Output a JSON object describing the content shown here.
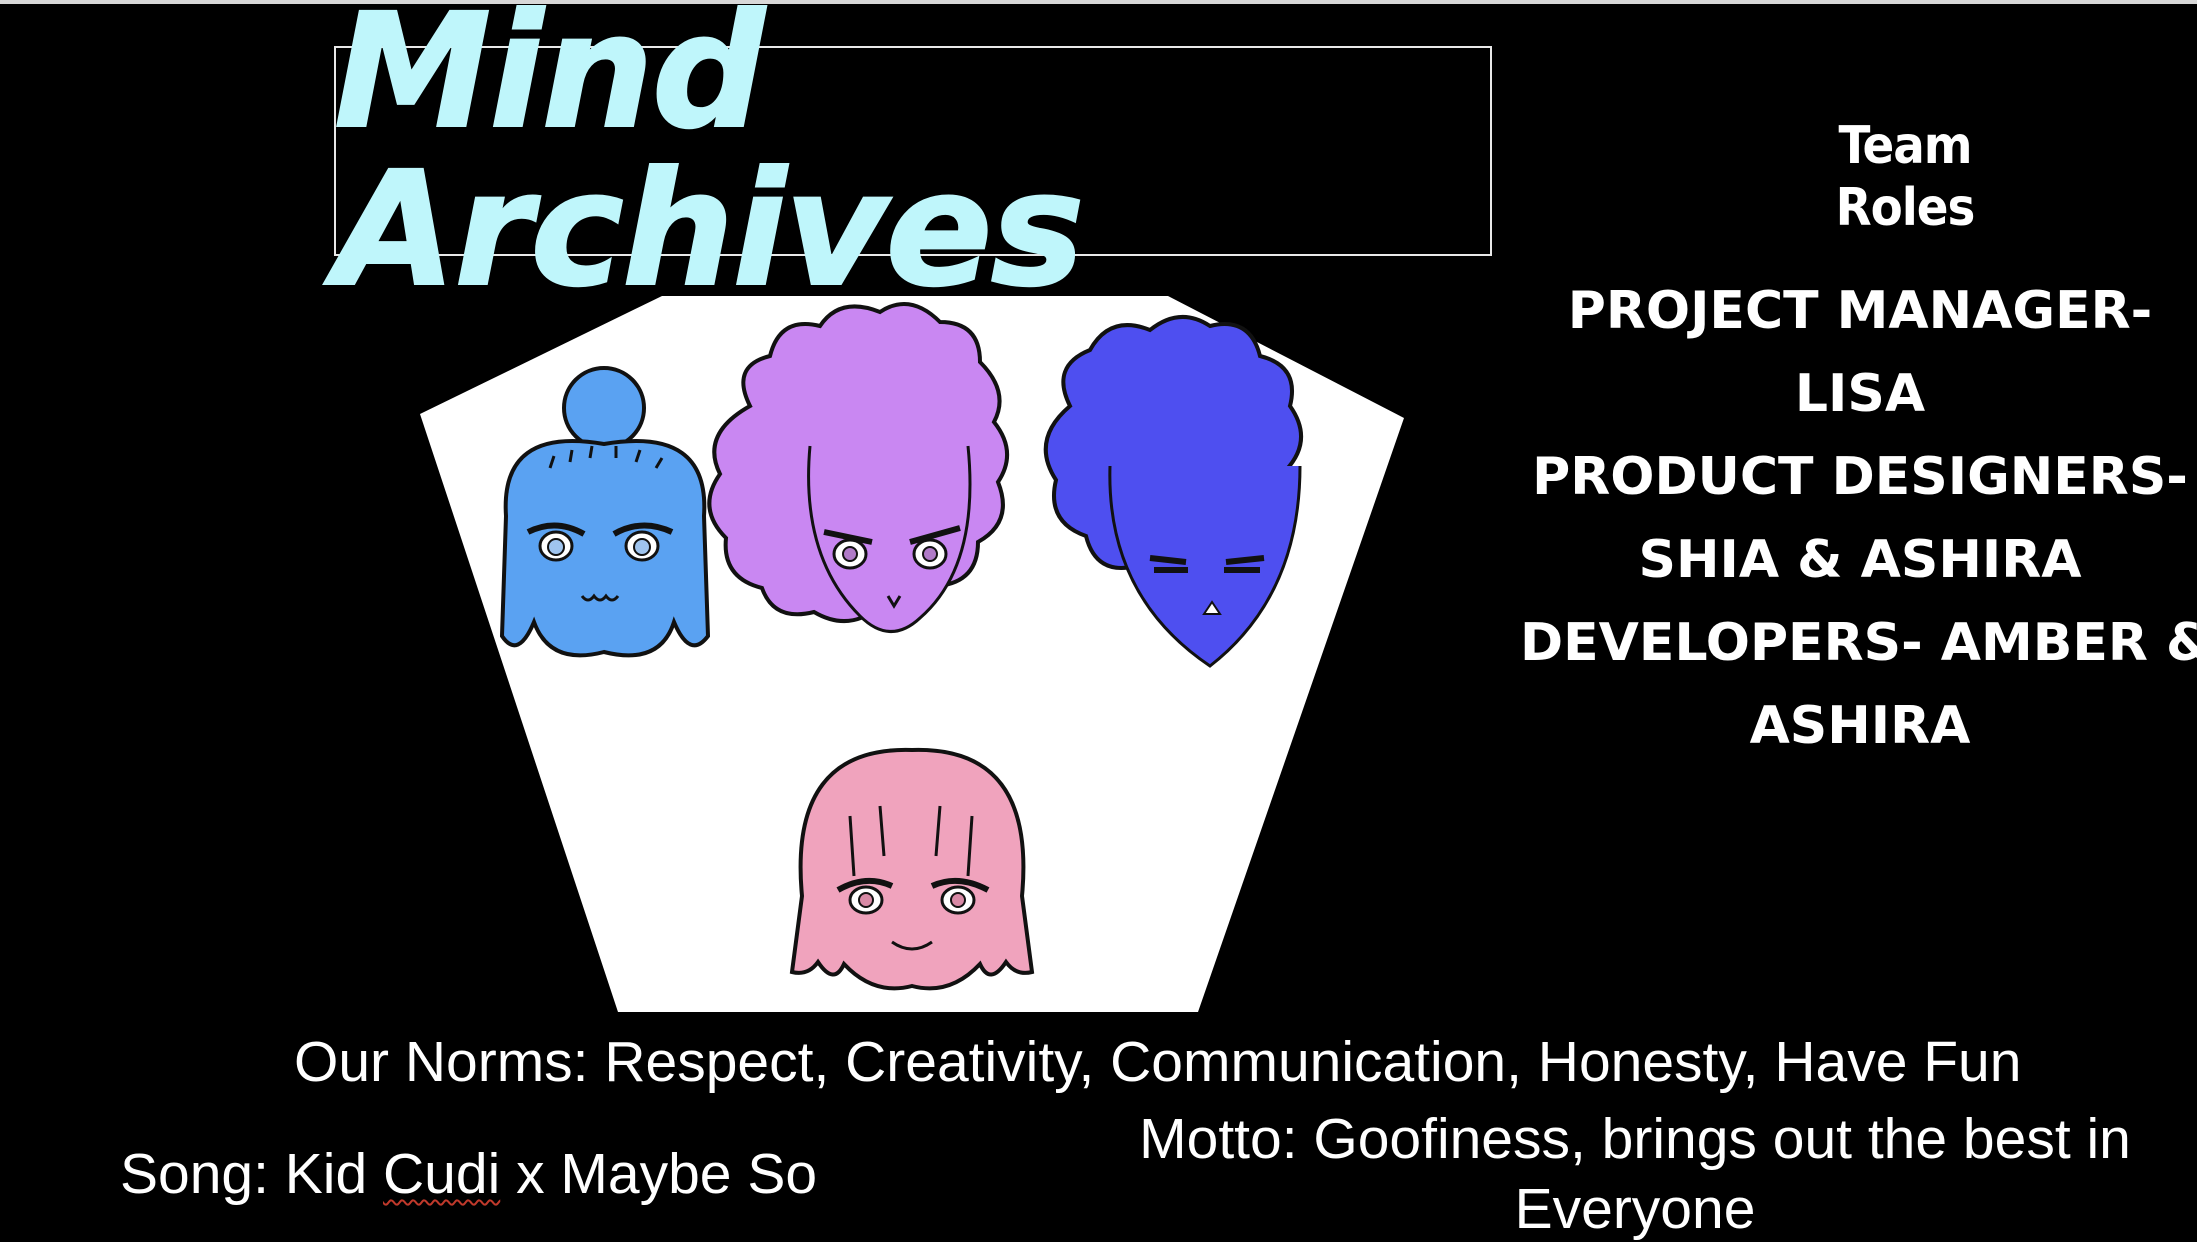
{
  "slide": {
    "title": "Mind Archives",
    "team_roles_heading": "Team Roles",
    "roles": [
      "Project Manager-",
      "Lisa",
      "Product Designers-",
      "Shia & Ashira",
      "Developers- Amber &",
      "Ashira"
    ],
    "norms": "Our Norms: Respect, Creativity, Communication, Honesty, Have Fun",
    "motto_line1": "Motto: Goofiness, brings out the best in",
    "motto_line2": "Everyone",
    "song_prefix": "Song: Kid ",
    "song_flagged": "Cudi",
    "song_suffix": " x Maybe So"
  },
  "colors": {
    "background": "#000000",
    "title_text": "#bff6fb",
    "face_blue": "#5aa2f2",
    "face_purple": "#c987f2",
    "face_indigo": "#4e4ff0",
    "face_pink": "#f0a3bd"
  },
  "icons": [
    "team-illustration"
  ]
}
